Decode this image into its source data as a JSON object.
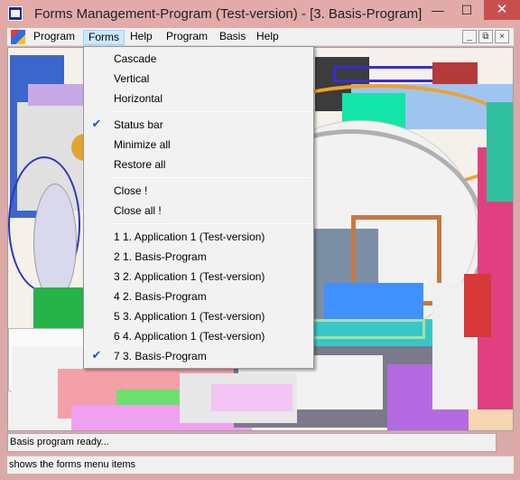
{
  "window": {
    "title": "Forms Management-Program (Test-version) - [3. Basis-Program]",
    "minimize_glyph": "—",
    "maximize_glyph": "☐",
    "close_glyph": "✕"
  },
  "menubar": {
    "items": [
      "Program",
      "Forms",
      "Help",
      "Program",
      "Basis",
      "Help"
    ],
    "active": "Forms",
    "mdi_minimize_glyph": "_",
    "mdi_restore_glyph": "⧉",
    "mdi_close_glyph": "×"
  },
  "forms_menu": {
    "items": [
      {
        "label": "Cascade",
        "checked": false
      },
      {
        "label": "Vertical",
        "checked": false
      },
      {
        "label": "Horizontal",
        "checked": false
      },
      {
        "label": "Status bar",
        "checked": true
      },
      {
        "label": "Minimize all",
        "checked": false
      },
      {
        "label": "Restore all",
        "checked": false
      },
      {
        "label": "Close !",
        "checked": false
      },
      {
        "label": "Close all !",
        "checked": false
      },
      {
        "label": "1 1. Application 1 (Test-version)",
        "checked": false
      },
      {
        "label": "2 1. Basis-Program",
        "checked": false
      },
      {
        "label": "3 2. Application 1 (Test-version)",
        "checked": false
      },
      {
        "label": "4 2. Basis-Program",
        "checked": false
      },
      {
        "label": "5 3. Application 1 (Test-version)",
        "checked": false
      },
      {
        "label": "6 4. Application 1 (Test-version)",
        "checked": false
      },
      {
        "label": "7 3. Basis-Program",
        "checked": true
      }
    ],
    "check_glyph": "✔"
  },
  "status": {
    "message": "Basis program ready...",
    "hint": "shows the forms menu items"
  },
  "colors": {
    "titlebar": "#e3aaaa",
    "menu_bg": "#f2f2f2",
    "menu_active": "#cde8ff",
    "check": "#1d5aa5"
  }
}
